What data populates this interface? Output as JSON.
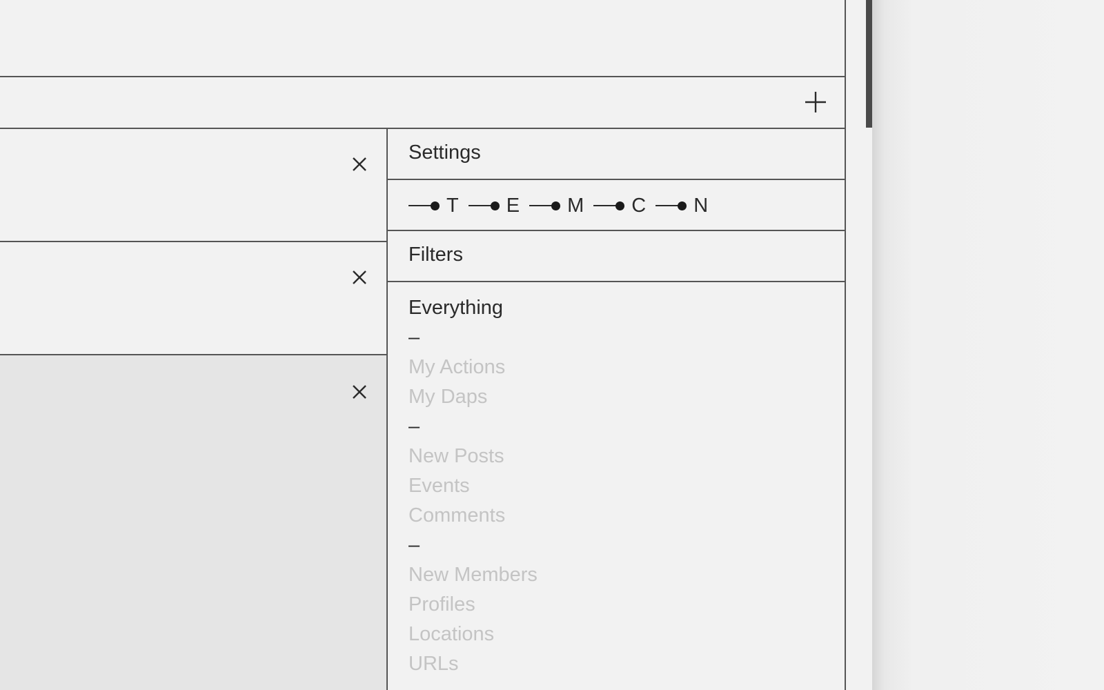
{
  "add_bar": {
    "add_icon": "plus-icon"
  },
  "cards": [
    {
      "close_icon": "close-icon"
    },
    {
      "close_icon": "close-icon"
    },
    {
      "close_icon": "close-icon"
    }
  ],
  "sidebar": {
    "settings_label": "Settings",
    "timeline": [
      "T",
      "E",
      "M",
      "C",
      "N"
    ],
    "filters_label": "Filters",
    "filters": [
      {
        "label": "Everything",
        "active": true
      },
      {
        "label": "–",
        "separator": true
      },
      {
        "label": "My Actions",
        "active": false
      },
      {
        "label": "My Daps",
        "active": false
      },
      {
        "label": "–",
        "separator": true
      },
      {
        "label": "New Posts",
        "active": false
      },
      {
        "label": "Events",
        "active": false
      },
      {
        "label": "Comments",
        "active": false
      },
      {
        "label": "–",
        "separator": true
      },
      {
        "label": "New Members",
        "active": false
      },
      {
        "label": "Profiles",
        "active": false
      },
      {
        "label": "Locations",
        "active": false
      },
      {
        "label": "URLs",
        "active": false
      }
    ]
  },
  "colors": {
    "background": "#f2f2f2",
    "border": "#555555",
    "text": "#2a2a2a",
    "inactive_text": "#c4c4c4",
    "selected_card": "#e5e5e5"
  }
}
